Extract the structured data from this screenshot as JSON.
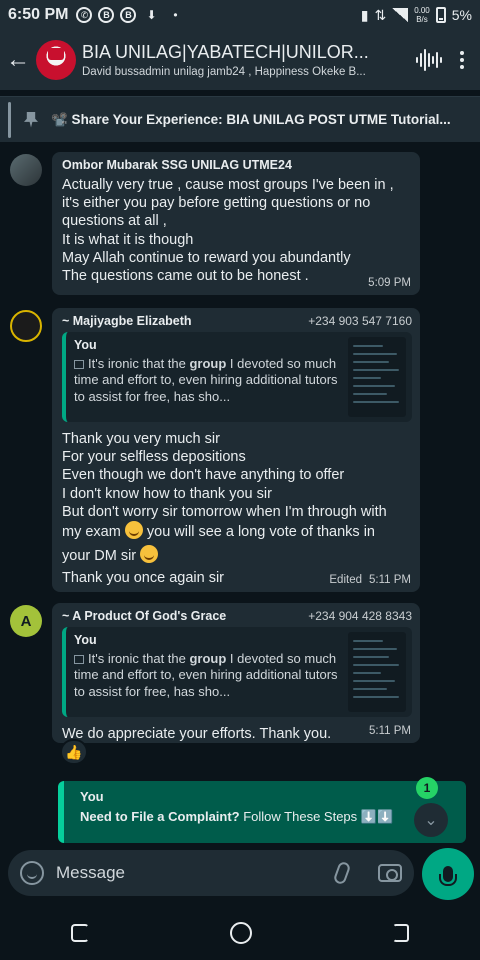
{
  "status": {
    "time": "6:50 PM",
    "speed_top": "0.00",
    "speed_bottom": "B/s",
    "battery": "5%"
  },
  "header": {
    "title": "BIA UNILAG|YABATECH|UNILOR...",
    "subtitle": "David bussadmin unilag jamb24 , Happiness Okeke B..."
  },
  "pinned": {
    "text": "📽️ Share Your Experience: BIA UNILAG POST UTME Tutorial..."
  },
  "messages": [
    {
      "sender": "Ombor Mubarak SSG UNILAG UTME24",
      "phone": "",
      "body": "Actually very true , cause most groups I've been in ,\nit's either you pay before getting questions or no\nquestions at all ,\nIt is what it is though\nMay Allah continue to reward you abundantly\nThe questions came out to be honest .",
      "time": "5:09 PM"
    },
    {
      "sender": "~ Majiyagbe Elizabeth",
      "phone": "+234 903 547 7160",
      "quote_author": "You",
      "quote_pre": "It's ironic that the ",
      "quote_bold": "group",
      "quote_post": " I devoted so much time and effort to, even hiring additional tutors to assist for free, has sho...",
      "body_1": "Thank you very much sir\nFor  your selfless depositions\nEven though we don't have anything to offer\nI don't know how to thank you sir\nBut don't worry sir tomorrow when I'm through with\nmy exam",
      "body_2": " you will see a long vote of thanks in",
      "body_3": "your DM sir",
      "body_4": "Thank you once again sir",
      "edited": "Edited",
      "time": "5:11 PM"
    },
    {
      "sender": "~ A Product Of God's Grace",
      "phone": "+234 904 428 8343",
      "avatar_letter": "A",
      "quote_author": "You",
      "quote_pre": "It's ironic that the ",
      "quote_bold": "group",
      "quote_post": " I devoted so much time and effort to, even hiring additional tutors to assist for free, has sho...",
      "body": "We do appreciate your efforts.  Thank you.",
      "time": "5:11 PM",
      "reaction": "👍"
    }
  ],
  "reply_preview": {
    "author": "You",
    "bold": "Need to File a Complaint?",
    "rest": " Follow These Steps ⬇️⬇️",
    "unread_count": "1"
  },
  "composer": {
    "placeholder": "Message"
  },
  "colors": {
    "accent": "#00a884",
    "bubble": "#1f2c34",
    "background": "#0b141a"
  }
}
